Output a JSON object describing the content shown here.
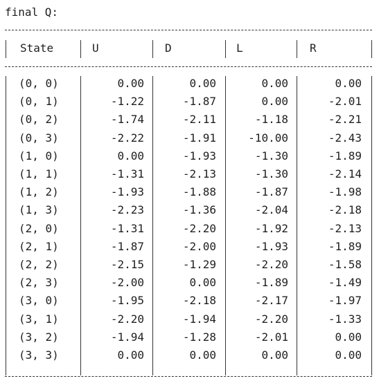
{
  "top_clip": "-----------------------------------",
  "title": "final Q:",
  "columns": [
    "State",
    "U",
    "D",
    "L",
    "R"
  ],
  "rows": [
    {
      "state": "(0, 0)",
      "u": "0.00",
      "d": "0.00",
      "l": "0.00",
      "r": "0.00"
    },
    {
      "state": "(0, 1)",
      "u": "-1.22",
      "d": "-1.87",
      "l": "0.00",
      "r": "-2.01"
    },
    {
      "state": "(0, 2)",
      "u": "-1.74",
      "d": "-2.11",
      "l": "-1.18",
      "r": "-2.21"
    },
    {
      "state": "(0, 3)",
      "u": "-2.22",
      "d": "-1.91",
      "l": "-10.00",
      "r": "-2.43"
    },
    {
      "state": "(1, 0)",
      "u": "0.00",
      "d": "-1.93",
      "l": "-1.30",
      "r": "-1.89"
    },
    {
      "state": "(1, 1)",
      "u": "-1.31",
      "d": "-2.13",
      "l": "-1.30",
      "r": "-2.14"
    },
    {
      "state": "(1, 2)",
      "u": "-1.93",
      "d": "-1.88",
      "l": "-1.87",
      "r": "-1.98"
    },
    {
      "state": "(1, 3)",
      "u": "-2.23",
      "d": "-1.36",
      "l": "-2.04",
      "r": "-2.18"
    },
    {
      "state": "(2, 0)",
      "u": "-1.31",
      "d": "-2.20",
      "l": "-1.92",
      "r": "-2.13"
    },
    {
      "state": "(2, 1)",
      "u": "-1.87",
      "d": "-2.00",
      "l": "-1.93",
      "r": "-1.89"
    },
    {
      "state": "(2, 2)",
      "u": "-2.15",
      "d": "-1.29",
      "l": "-2.20",
      "r": "-1.58"
    },
    {
      "state": "(2, 3)",
      "u": "-2.00",
      "d": "0.00",
      "l": "-1.89",
      "r": "-1.49"
    },
    {
      "state": "(3, 0)",
      "u": "-1.95",
      "d": "-2.18",
      "l": "-2.17",
      "r": "-1.97"
    },
    {
      "state": "(3, 1)",
      "u": "-2.20",
      "d": "-1.94",
      "l": "-2.20",
      "r": "-1.33"
    },
    {
      "state": "(3, 2)",
      "u": "-1.94",
      "d": "-1.28",
      "l": "-2.01",
      "r": "0.00"
    },
    {
      "state": "(3, 3)",
      "u": "0.00",
      "d": "0.00",
      "l": "0.00",
      "r": "0.00"
    }
  ]
}
